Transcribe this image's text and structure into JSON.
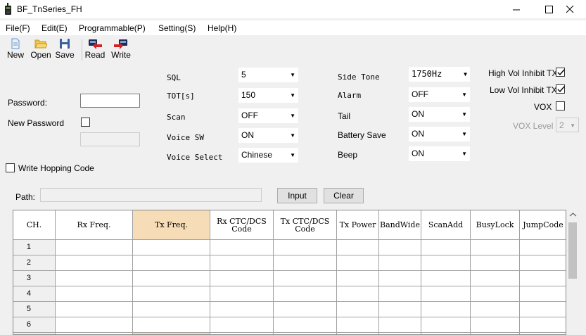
{
  "window": {
    "title": "BF_TnSeries_FH",
    "minimize_icon": "minimize-icon",
    "maximize_icon": "maximize-icon",
    "close_icon": "close-icon"
  },
  "menu": [
    "File(F)",
    "Edit(E)",
    "Programmable(P)",
    "Setting(S)",
    "Help(H)"
  ],
  "toolbar": {
    "new": "New",
    "open": "Open",
    "save": "Save",
    "read": "Read",
    "write": "Write"
  },
  "password": {
    "password_label": "Password:",
    "password_value": "",
    "new_password_label": "New Password",
    "new_password_checked": false,
    "new_password_value": ""
  },
  "write_hopping": {
    "label": "Write Hopping Code",
    "checked": false
  },
  "settings_col1": [
    {
      "label": "SQL",
      "value": "5"
    },
    {
      "label": "TOT[s]",
      "value": "150"
    },
    {
      "label": "Scan",
      "value": "OFF"
    },
    {
      "label": "Voice SW",
      "value": "ON"
    },
    {
      "label": "Voice Select",
      "value": "Chinese"
    }
  ],
  "settings_col2": [
    {
      "label": "Side Tone",
      "value": "1750Hz"
    },
    {
      "label": "Alarm",
      "value": "OFF"
    },
    {
      "label": "Tail",
      "value": "ON"
    },
    {
      "label": "Battery Save",
      "value": "ON"
    },
    {
      "label": "Beep",
      "value": "ON"
    }
  ],
  "checks_right": [
    {
      "label": "High Vol Inhibit TX",
      "checked": true
    },
    {
      "label": "Low Vol Inhibit TX",
      "checked": true
    },
    {
      "label": "VOX",
      "checked": false
    }
  ],
  "vox_level": {
    "label": "VOX Level",
    "value": "2"
  },
  "path": {
    "label": "Path:",
    "value": "",
    "input_button": "Input",
    "clear_button": "Clear"
  },
  "table": {
    "columns": [
      "CH.",
      "Rx Freq.",
      "Tx Freq.",
      "Rx CTC/DCS\nCode",
      "Tx CTC/DCS\nCode",
      "Tx Power",
      "BandWide",
      "ScanAdd",
      "BusyLock",
      "JumpCode"
    ],
    "selected_column": 2,
    "rows": [
      "1",
      "2",
      "3",
      "4",
      "5",
      "6",
      ""
    ]
  }
}
